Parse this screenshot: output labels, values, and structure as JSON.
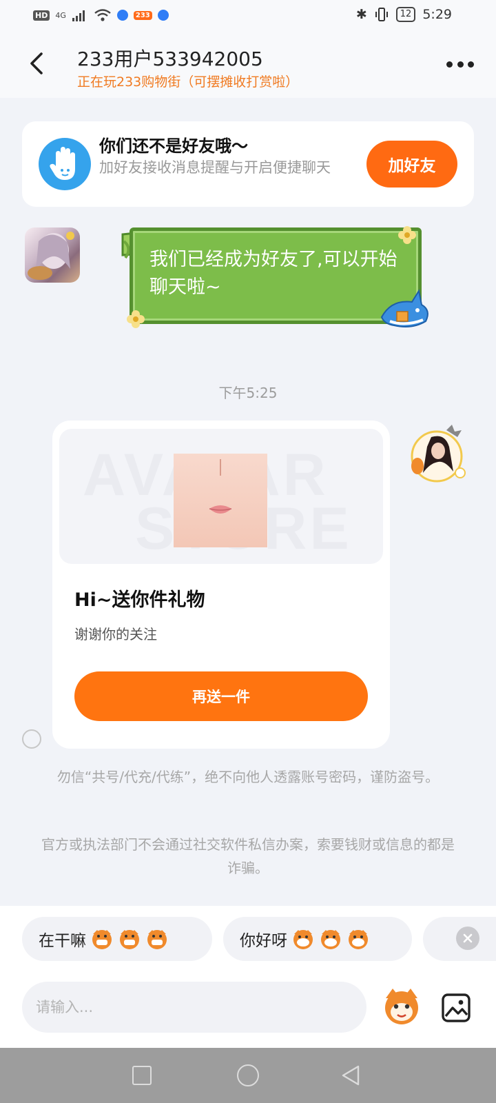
{
  "status_bar": {
    "hd": "HD",
    "network": "4G",
    "app_badge": "233",
    "battery": "12",
    "time": "5:29"
  },
  "header": {
    "title": "233用户533942005",
    "subtitle": "正在玩233购物街（可摆摊收打赏啦）",
    "back_icon": "chevron-left-icon",
    "more_icon": "more-dots-icon"
  },
  "friend_banner": {
    "title": "你们还不是好友哦～",
    "description": "加好友接收消息提醒与开启便捷聊天",
    "button_label": "加好友",
    "icon": "hand-icon"
  },
  "messages": {
    "received_text": "我们已经成为好友了,可以开始聊天啦~",
    "timestamp": "下午5:25",
    "gift_card": {
      "watermark_line1": "AVATAR",
      "watermark_line2": "STORE",
      "title": "Hi~送你件礼物",
      "description": "谢谢你的关注",
      "button_label": "再送一件"
    }
  },
  "notices": [
    "勿信“共号/代充/代练”，绝不向他人透露账号密码，谨防盗号。",
    "官方或执法部门不会通过社交软件私信办案，索要钱财或信息的都是诈骗。"
  ],
  "quick_replies": [
    {
      "label": "在干嘛"
    },
    {
      "label": "你好呀"
    }
  ],
  "input": {
    "placeholder": "请输入..."
  },
  "colors": {
    "accent_orange": "#ff6a12",
    "subtitle_orange": "#f07a21",
    "bubble_green": "#7dbd4a",
    "hand_blue": "#35a3ec"
  }
}
